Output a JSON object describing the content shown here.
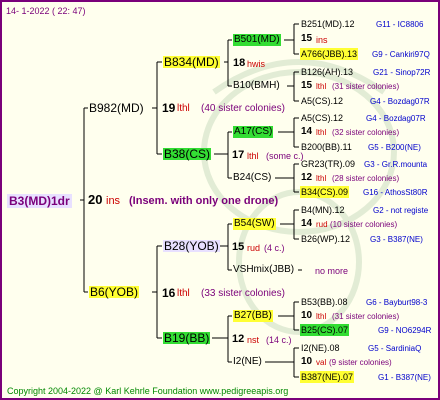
{
  "date": "14-  1-2022 ( 22: 47)",
  "copyright": "Copyright 2004-2022 @ Karl Kehrle Foundation    www.pedigreeapis.org",
  "root": {
    "label": "B3(MD)1dr",
    "num": "20",
    "mark": "ins",
    "note": "(Insem. with only one drone)"
  },
  "gen1": [
    {
      "label": "B982(MD)",
      "num": "19",
      "mark": "lthl",
      "note": "(40 sister colonies)"
    },
    {
      "label": "B6(YOB)",
      "num": "16",
      "mark": "lthl",
      "note": "(33 sister colonies)"
    }
  ],
  "gen2": [
    {
      "label": "B834(MD)",
      "num": "18",
      "mark": "hwis",
      "note": ""
    },
    {
      "label": "B38(CS)",
      "num": "17",
      "mark": "lthl",
      "note": "(some c.)"
    },
    {
      "label": "B28(YOB)",
      "num": "15",
      "mark": "rud",
      "note": "(4 c.)"
    },
    {
      "label": "B19(BB)",
      "num": "12",
      "mark": "nst",
      "note": "(14 c.)"
    }
  ],
  "gen3": [
    {
      "label": "B501(MD)"
    },
    {
      "label": "B10(BMH)"
    },
    {
      "label": "A17(CS)"
    },
    {
      "label": "B24(CS)"
    },
    {
      "label": "B54(SW)",
      "num": "14",
      "mark": "rud",
      "note": "(10 sister colonies)"
    },
    {
      "label": "VSHmix(JBB)",
      "more": "no more"
    },
    {
      "label": "B27(BB)",
      "num": "10",
      "mark": "lthl",
      "note": "(31 sister colonies)"
    },
    {
      "label": "I2(NE)",
      "num": "10",
      "mark": "val",
      "note": "(9 sister colonies)"
    }
  ],
  "gen4": [
    {
      "label": "B251(MD).12",
      "loc": "G11 - IC8806"
    },
    {
      "num": "15",
      "mark": "ins"
    },
    {
      "label": "A766(JBB).13",
      "loc": "G9 - Cankiri97Q"
    },
    {
      "label": "B126(AH).13",
      "loc": "G21 - Sinop72R"
    },
    {
      "num": "15",
      "mark": "lthl",
      "note": "(31 sister colonies)"
    },
    {
      "label": "A5(CS).12",
      "loc": "G4 - Bozdag07R"
    },
    {
      "label": "A5(CS).12",
      "loc": "G4 - Bozdag07R"
    },
    {
      "num": "14",
      "mark": "lthl",
      "note": "(32 sister colonies)"
    },
    {
      "label": "B200(BB).11",
      "loc": "G5 - B200(NE)"
    },
    {
      "label": "GR23(TR).09",
      "loc": "G3 - Gr.R.mounta"
    },
    {
      "num": "12",
      "mark": "lthl",
      "note": "(28 sister colonies)"
    },
    {
      "label": "B34(CS).09",
      "loc": "G16 - AthosSt80R"
    },
    {
      "label": "B4(MN).12",
      "loc": "G2 - not registe"
    },
    {
      "label": "B26(WP).12",
      "loc": "G3 - B387(NE)"
    },
    {
      "label": "B53(BB).08",
      "loc": "G6 - Bayburt98-3"
    },
    {
      "label": "B25(CS).07",
      "loc": "G9 - NO6294R"
    },
    {
      "label": "I2(NE).08",
      "loc": "G5 - SardiniaQ"
    },
    {
      "label": "B387(NE).07",
      "loc": "G1 - B387(NE)"
    }
  ]
}
